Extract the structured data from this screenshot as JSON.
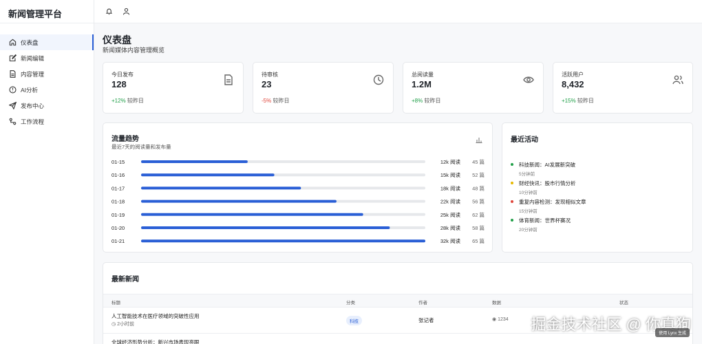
{
  "app": {
    "title": "新闻管理平台"
  },
  "sidebar": {
    "items": [
      {
        "label": "仪表盘",
        "icon": "home-icon",
        "active": true
      },
      {
        "label": "新闻编辑",
        "icon": "edit-icon",
        "active": false
      },
      {
        "label": "内容管理",
        "icon": "document-icon",
        "active": false
      },
      {
        "label": "AI分析",
        "icon": "ai-icon",
        "active": false
      },
      {
        "label": "发布中心",
        "icon": "send-icon",
        "active": false
      },
      {
        "label": "工作流程",
        "icon": "workflow-icon",
        "active": false
      }
    ]
  },
  "topbar": {
    "icons": [
      "bell-icon",
      "user-icon"
    ]
  },
  "page": {
    "title": "仪表盘",
    "subtitle": "新闻媒体内容管理概览"
  },
  "stats": [
    {
      "label": "今日发布",
      "value": "128",
      "change": "+12%",
      "change_suffix": "较昨日",
      "trend": "up",
      "icon": "file-icon"
    },
    {
      "label": "待审核",
      "value": "23",
      "change": "-5%",
      "change_suffix": "较昨日",
      "trend": "down",
      "icon": "clock-icon"
    },
    {
      "label": "总阅读量",
      "value": "1.2M",
      "change": "+8%",
      "change_suffix": "较昨日",
      "trend": "up",
      "icon": "eye-icon"
    },
    {
      "label": "活跃用户",
      "value": "8,432",
      "change": "+15%",
      "change_suffix": "较昨日",
      "trend": "up",
      "icon": "users-icon"
    }
  ],
  "traffic": {
    "title": "流量趋势",
    "subtitle": "最近7天的阅读量和发布量",
    "icon": "bar-chart-icon"
  },
  "chart_data": {
    "type": "bar",
    "categories": [
      "01-15",
      "01-16",
      "01-17",
      "01-18",
      "01-19",
      "01-20",
      "01-21"
    ],
    "reads": [
      12,
      15,
      18,
      22,
      25,
      28,
      32
    ],
    "read_labels": [
      "12k 阅读",
      "15k 阅读",
      "18k 阅读",
      "22k 阅读",
      "25k 阅读",
      "28k 阅读",
      "32k 阅读"
    ],
    "posts": [
      45,
      52,
      48,
      56,
      62,
      58,
      65
    ],
    "post_labels": [
      "45 篇",
      "52 篇",
      "48 篇",
      "56 篇",
      "62 篇",
      "58 篇",
      "65 篇"
    ],
    "max": 32,
    "bar_color": "#2a5fd6",
    "track_color": "#e6e8eb"
  },
  "activity": {
    "title": "最近活动",
    "items": [
      {
        "text": "科技新闻：AI发展新突破",
        "time": "5分钟前",
        "color": "#22a04a"
      },
      {
        "text": "财经快讯：股市行情分析",
        "time": "10分钟前",
        "color": "#e6b800"
      },
      {
        "text": "重复内容检测：发现相似文章",
        "time": "15分钟前",
        "color": "#e0453a"
      },
      {
        "text": "体育新闻：世界杯赛况",
        "time": "20分钟前",
        "color": "#22a04a"
      }
    ]
  },
  "news": {
    "title": "最新新闻",
    "headers": [
      "标题",
      "分类",
      "作者",
      "数据",
      "状态"
    ],
    "rows": [
      {
        "title": "人工智能技术在医疗领域的突破性应用",
        "time": "2小时前",
        "category": "科技",
        "author": "张记者",
        "data": "1234"
      },
      {
        "title": "全球经济形势分析：新兴市场表现亮眼",
        "time": "",
        "category": "",
        "author": "",
        "data": ""
      }
    ]
  },
  "watermark": {
    "text": "掘金技术社区 @ 你真狗",
    "badge": "使用 Lynx 生成"
  }
}
